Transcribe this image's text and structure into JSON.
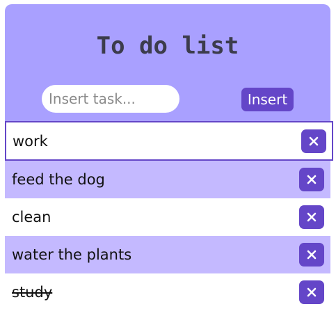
{
  "header": {
    "title": "To do list"
  },
  "task_input": {
    "placeholder": "Insert task...",
    "value": ""
  },
  "insert_button": {
    "label": "Insert"
  },
  "delete_icon": "close-icon",
  "tasks": [
    {
      "label": "work",
      "state": "selected",
      "done": false
    },
    {
      "label": "feed the dog",
      "state": "normal",
      "done": false
    },
    {
      "label": "clean",
      "state": "normal",
      "done": false
    },
    {
      "label": "water the plants",
      "state": "normal",
      "done": false
    },
    {
      "label": "study",
      "state": "normal",
      "done": true
    }
  ],
  "colors": {
    "header_bg": "#a9a0ff",
    "row_alt_bg": "#c4b9ff",
    "accent": "#6446c8",
    "title_text": "#3c3c4c"
  }
}
